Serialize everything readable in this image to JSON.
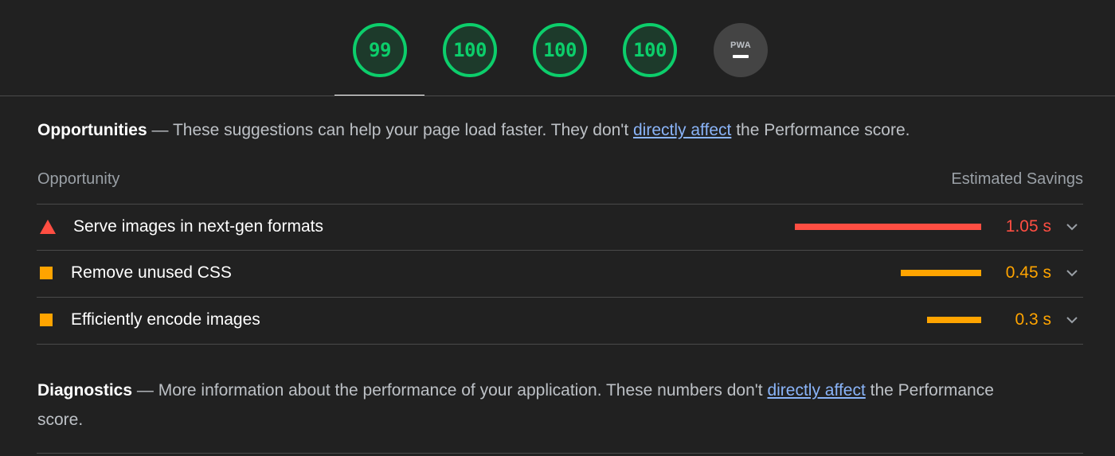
{
  "scores": {
    "gauges": [
      {
        "value": "99",
        "status": "pass"
      },
      {
        "value": "100",
        "status": "pass"
      },
      {
        "value": "100",
        "status": "pass"
      },
      {
        "value": "100",
        "status": "pass"
      }
    ],
    "pwa": {
      "label": "PWA",
      "icon": "dash-icon"
    },
    "pass_color": "#0cce6b"
  },
  "opportunities": {
    "title": "Opportunities",
    "dash": "—",
    "desc_before": "These suggestions can help your page load faster. They don't",
    "link": "directly affect",
    "desc_after": "the Performance score.",
    "col_left": "Opportunity",
    "col_right": "Estimated Savings",
    "items": [
      {
        "title": "Serve images in next-gen formats",
        "savings": "1.05 s",
        "severity": "fail",
        "icon": "warning-triangle-icon",
        "color": "#ff4e42",
        "bar_fraction": 1.0
      },
      {
        "title": "Remove unused CSS",
        "savings": "0.45 s",
        "severity": "average",
        "icon": "average-square-icon",
        "color": "#ffa400",
        "bar_fraction": 0.43
      },
      {
        "title": "Efficiently encode images",
        "savings": "0.3 s",
        "severity": "average",
        "icon": "average-square-icon",
        "color": "#ffa400",
        "bar_fraction": 0.29
      }
    ]
  },
  "diagnostics": {
    "title": "Diagnostics",
    "dash": "—",
    "desc_before": "More information about the performance of your application. These numbers don't",
    "link": "directly affect",
    "desc_after": "the Performance score."
  }
}
